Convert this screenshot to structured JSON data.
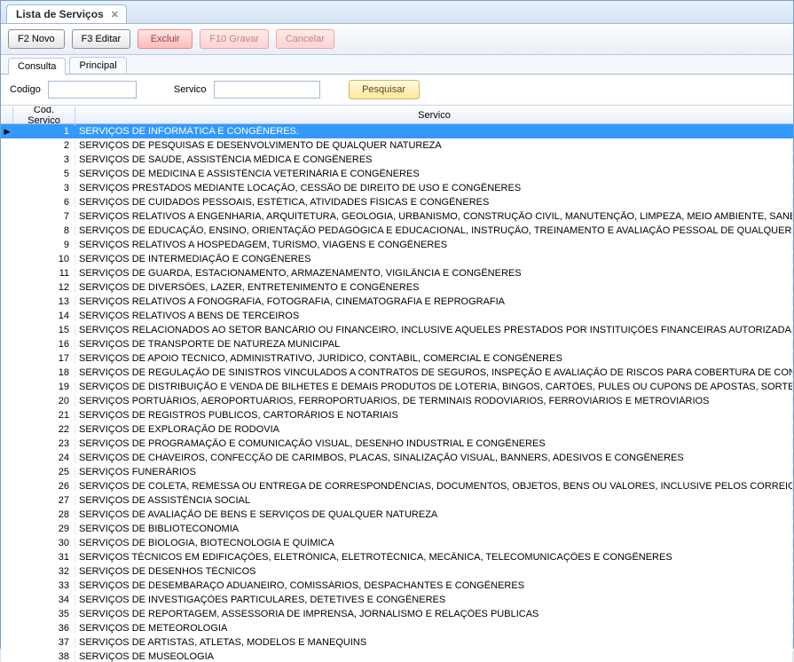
{
  "window": {
    "title": "Lista de Serviços"
  },
  "toolbar": {
    "novo": "F2 Novo",
    "editar": "F3 Editar",
    "excluir": "Excluir",
    "gravar": "F10 Gravar",
    "cancelar": "Cancelar"
  },
  "tabs": {
    "consulta": "Consulta",
    "principal": "Principal"
  },
  "filter": {
    "codigo_label": "Codigo",
    "codigo_value": "",
    "servico_label": "Servico",
    "servico_value": "",
    "pesquisar": "Pesquisar"
  },
  "grid": {
    "header_code": "Cod. Servico",
    "header_desc": "Servico",
    "selected_index": 0,
    "rows": [
      {
        "code": 1,
        "desc": "SERVIÇOS DE INFORMÁTICA E CONGÊNERES."
      },
      {
        "code": 2,
        "desc": "SERVIÇOS DE PESQUISAS E DESENVOLVIMENTO DE QUALQUER NATUREZA"
      },
      {
        "code": 3,
        "desc": "SERVIÇOS DE SAÚDE, ASSISTÊNCIA MÉDICA E CONGÊNERES"
      },
      {
        "code": 5,
        "desc": "SERVIÇOS DE MEDICINA E ASSISTÊNCIA VETERINÁRIA E CONGÊNERES"
      },
      {
        "code": 3,
        "desc": "SERVIÇOS PRESTADOS MEDIANTE LOCAÇÃO, CESSÃO DE DIREITO DE USO E CONGÊNERES"
      },
      {
        "code": 6,
        "desc": "SERVIÇOS DE CUIDADOS PESSOAIS, ESTÉTICA, ATIVIDADES FÍSICAS E CONGÊNERES"
      },
      {
        "code": 7,
        "desc": "SERVIÇOS RELATIVOS A ENGENHARIA, ARQUITETURA, GEOLOGIA, URBANISMO, CONSTRUÇÃO CIVIL, MANUTENÇÃO, LIMPEZA, MEIO AMBIENTE, SANEAM"
      },
      {
        "code": 8,
        "desc": "SERVIÇOS DE EDUCAÇÃO, ENSINO, ORIENTAÇÃO PEDAGÓGICA E EDUCACIONAL, INSTRUÇÃO, TREINAMENTO E AVALIAÇÃO PESSOAL DE QUALQUER GR"
      },
      {
        "code": 9,
        "desc": "SERVIÇOS RELATIVOS A HOSPEDAGEM, TURISMO, VIAGENS E CONGÊNERES"
      },
      {
        "code": 10,
        "desc": "SERVIÇOS DE INTERMEDIAÇÃO E CONGÊNERES"
      },
      {
        "code": 11,
        "desc": "SERVIÇOS DE GUARDA, ESTACIONAMENTO, ARMAZENAMENTO, VIGILÂNCIA E CONGÊNERES"
      },
      {
        "code": 12,
        "desc": "SERVIÇOS DE DIVERSÕES, LAZER, ENTRETENIMENTO E CONGÊNERES"
      },
      {
        "code": 13,
        "desc": "SERVIÇOS RELATIVOS A FONOGRAFIA, FOTOGRAFIA, CINEMATOGRAFIA E REPROGRAFIA"
      },
      {
        "code": 14,
        "desc": "SERVIÇOS RELATIVOS A BENS DE TERCEIROS"
      },
      {
        "code": 15,
        "desc": "SERVIÇOS RELACIONADOS AO SETOR BANCÁRIO OU FINANCEIRO, INCLUSIVE AQUELES PRESTADOS POR INSTITUIÇÕES FINANCEIRAS AUTORIZADAS A"
      },
      {
        "code": 16,
        "desc": "SERVIÇOS DE TRANSPORTE DE NATUREZA MUNICIPAL"
      },
      {
        "code": 17,
        "desc": "SERVIÇOS DE APOIO TÉCNICO, ADMINISTRATIVO, JURÍDICO, CONTÁBIL, COMERCIAL E CONGÊNERES"
      },
      {
        "code": 18,
        "desc": "SERVIÇOS DE REGULAÇÃO DE SINISTROS VINCULADOS A CONTRATOS DE SEGUROS, INSPEÇÃO E AVALIAÇÃO DE RISCOS PARA COBERTURA DE CONT"
      },
      {
        "code": 19,
        "desc": "SERVIÇOS DE DISTRIBUIÇÃO E VENDA DE BILHETES E DEMAIS PRODUTOS DE LOTERIA, BINGOS, CARTÕES, PULES OU CUPONS DE APOSTAS, SORTEIO"
      },
      {
        "code": 20,
        "desc": "SERVIÇOS PORTUÁRIOS, AEROPORTUÁRIOS, FERROPORTUÁRIOS, DE TERMINAIS RODOVIÁRIOS, FERROVIÁRIOS E METROVIÁRIOS"
      },
      {
        "code": 21,
        "desc": "SERVIÇOS DE REGISTROS PÚBLICOS, CARTORÁRIOS E NOTARIAIS"
      },
      {
        "code": 22,
        "desc": "SERVIÇOS DE EXPLORAÇÃO DE RODOVIA"
      },
      {
        "code": 23,
        "desc": "SERVIÇOS DE PROGRAMAÇÃO E COMUNICAÇÃO VISUAL, DESENHO INDUSTRIAL E CONGÊNERES"
      },
      {
        "code": 24,
        "desc": "SERVIÇOS DE CHAVEIROS, CONFECÇÃO DE CARIMBOS, PLACAS, SINALIZAÇÃO VISUAL, BANNERS, ADESIVOS E CONGÊNERES"
      },
      {
        "code": 25,
        "desc": "SERVIÇOS FUNERÁRIOS"
      },
      {
        "code": 26,
        "desc": "SERVIÇOS DE COLETA, REMESSA OU ENTREGA DE CORRESPONDÊNCIAS, DOCUMENTOS, OBJETOS, BENS OU VALORES, INCLUSIVE PELOS CORREIOS E"
      },
      {
        "code": 27,
        "desc": "SERVIÇOS DE ASSISTÊNCIA SOCIAL"
      },
      {
        "code": 28,
        "desc": "SERVIÇOS DE AVALIAÇÃO DE BENS E SERVIÇOS DE QUALQUER NATUREZA"
      },
      {
        "code": 29,
        "desc": "SERVIÇOS DE BIBLIOTECONOMIA"
      },
      {
        "code": 30,
        "desc": "SERVIÇOS DE BIOLOGIA, BIOTECNOLOGIA E QUÍMICA"
      },
      {
        "code": 31,
        "desc": "SERVIÇOS TÉCNICOS EM EDIFICAÇÕES, ELETRÔNICA, ELETROTÉCNICA, MECÂNICA, TELECOMUNICAÇÕES E CONGÊNERES"
      },
      {
        "code": 32,
        "desc": "SERVIÇOS DE DESENHOS TÉCNICOS"
      },
      {
        "code": 33,
        "desc": "SERVIÇOS DE DESEMBARAÇO ADUANEIRO, COMISSÁRIOS, DESPACHANTES E CONGÊNERES"
      },
      {
        "code": 34,
        "desc": "SERVIÇOS DE INVESTIGAÇÕES PARTICULARES, DETETIVES E CONGÊNERES"
      },
      {
        "code": 35,
        "desc": "SERVIÇOS DE REPORTAGEM, ASSESSORIA DE IMPRENSA, JORNALISMO E RELAÇÕES PÚBLICAS"
      },
      {
        "code": 36,
        "desc": "SERVIÇOS DE METEOROLOGIA"
      },
      {
        "code": 37,
        "desc": "SERVIÇOS DE ARTISTAS, ATLETAS, MODELOS E MANEQUINS"
      },
      {
        "code": 38,
        "desc": "SERVIÇOS DE MUSEOLOGIA"
      }
    ]
  }
}
